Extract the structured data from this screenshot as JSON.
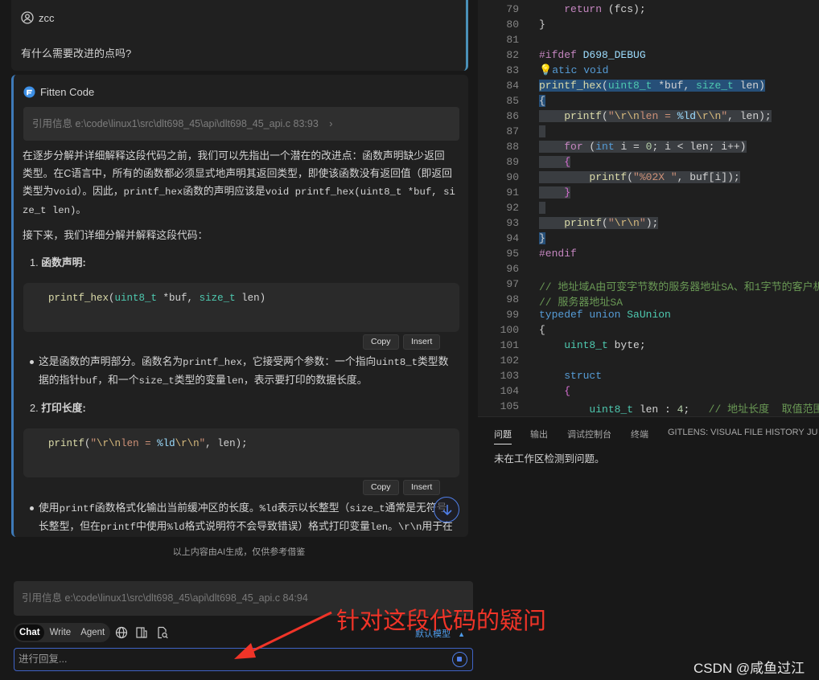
{
  "chat": {
    "user": {
      "name": "zcc",
      "question": "有什么需要改进的点吗?"
    },
    "ai": {
      "name": "Fitten Code",
      "ref_label": "引用信息 e:\\code\\linux1\\src\\dlt698_45\\api\\dlt698_45_api.c 83:93",
      "p1_a": "在逐步分解并详细解释这段代码之前，我们可以先指出一个潜在的改进点：函数声明缺少返回",
      "p1_b": "类型。在C语言中，所有的函数都必须显式地声明其返回类型，即使该函数没有返回值（即返回",
      "p1_c1": "类型为",
      "p1_c2": "void",
      "p1_c3": "）。因此，",
      "p1_c4": "printf_hex",
      "p1_c5": "函数的声明应该是",
      "p1_c6": "void printf_hex(uint8_t *buf, si",
      "p1_d": "ze_t len)",
      "p1_d2": "。",
      "p2": "接下来，我们详细分解并解释这段代码：",
      "item1_num": "1.",
      "item1_title": "函数声明:",
      "code1": "printf_hex(uint8_t *buf, size_t len)",
      "copy": "Copy",
      "insert": "Insert",
      "b1_a": "这是函数的声明部分。函数名为",
      "b1_b": "printf_hex",
      "b1_c": "，它接受两个参数：一个指向",
      "b1_d": "uint8_t",
      "b1_e": "类型数",
      "b1_f": "据的指针",
      "b1_g": "buf",
      "b1_h": "，和一个",
      "b1_i": "size_t",
      "b1_j": "类型的变量",
      "b1_k": "len",
      "b1_l": "，表示要打印的数据长度。",
      "item2_num": "2.",
      "item2_title": "打印长度:",
      "code2": "printf(\"\\r\\nlen = %ld\\r\\n\", len);",
      "b2_a": "使用",
      "b2_b": "printf",
      "b2_c": "函数格式化输出当前缓冲区的长度。",
      "b2_d": "%ld",
      "b2_e": "表示以长整型（",
      "b2_f": "size_t",
      "b2_g": "通常是无符号",
      "b2_h": "长整型，但在",
      "b2_i": "printf",
      "b2_j": "中使用",
      "b2_k": "%ld",
      "b2_l": "格式说明符不会导致错误）格式打印变量",
      "b2_m": "len",
      "b2_n": "。",
      "b2_o": "\\r\\n",
      "b2_p": "用于在"
    },
    "disclaimer": "以上内容由AI生成，仅供参考借鉴",
    "input_ref": "引用信息 e:\\code\\linux1\\src\\dlt698_45\\api\\dlt698_45_api.c 84:94",
    "modes": [
      "Chat",
      "Write",
      "Agent"
    ],
    "model": "默认模型",
    "input_placeholder": "进行回复..."
  },
  "editor": {
    "line_numbers": [
      "79",
      "80",
      "81",
      "82",
      "83",
      "84",
      "85",
      "86",
      "87",
      "88",
      "89",
      "90",
      "91",
      "92",
      "93",
      "94",
      "95",
      "96",
      "97",
      "98",
      "99",
      "100",
      "101",
      "102",
      "103",
      "104",
      "105"
    ]
  },
  "panel": {
    "tabs": [
      "问题",
      "输出",
      "调试控制台",
      "终端",
      "GITLENS: VISUAL FILE HISTORY",
      "JU"
    ],
    "message": "未在工作区检测到问题。"
  },
  "annotation": "针对这段代码的疑问",
  "watermark": "CSDN @咸鱼过江",
  "colors": {
    "accent": "#4f7ee8",
    "annotation": "#f03428",
    "selection": "#264f78"
  }
}
